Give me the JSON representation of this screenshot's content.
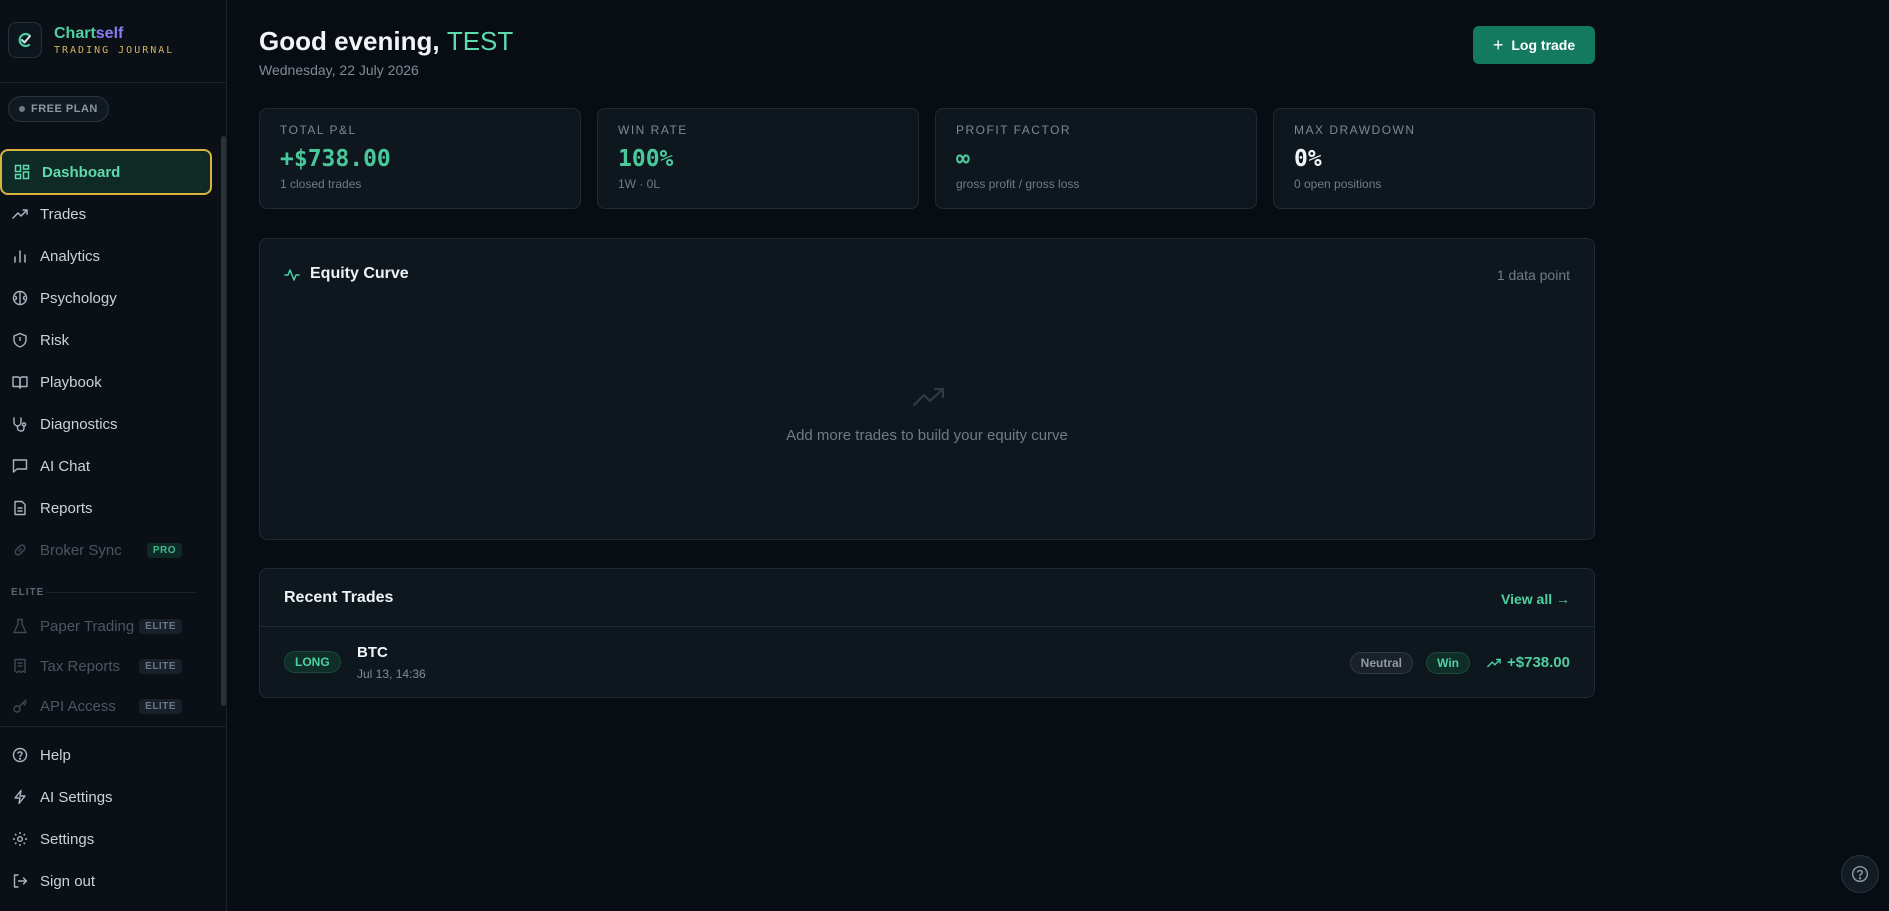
{
  "brand": {
    "name_part1": "Chart",
    "name_part2": "self",
    "subtitle": "TRADING JOURNAL"
  },
  "plan": {
    "label": "FREE PLAN"
  },
  "sidebar": {
    "items": [
      {
        "label": "Dashboard",
        "icon": "dashboard-icon"
      },
      {
        "label": "Trades",
        "icon": "trending-up-icon"
      },
      {
        "label": "Analytics",
        "icon": "bar-chart-icon"
      },
      {
        "label": "Psychology",
        "icon": "brain-icon"
      },
      {
        "label": "Risk",
        "icon": "shield-icon"
      },
      {
        "label": "Playbook",
        "icon": "book-icon"
      },
      {
        "label": "Diagnostics",
        "icon": "stethoscope-icon"
      },
      {
        "label": "AI Chat",
        "icon": "chat-icon"
      },
      {
        "label": "Reports",
        "icon": "document-icon"
      },
      {
        "label": "Broker Sync",
        "icon": "link-icon",
        "tag": "PRO"
      }
    ],
    "elite_label": "ELITE",
    "elite_items": [
      {
        "label": "Paper Trading",
        "icon": "flask-icon",
        "tag": "ELITE"
      },
      {
        "label": "Tax Reports",
        "icon": "receipt-icon",
        "tag": "ELITE"
      },
      {
        "label": "API Access",
        "icon": "key-icon",
        "tag": "ELITE"
      }
    ],
    "bottom_items": [
      {
        "label": "Help",
        "icon": "help-circle-icon"
      },
      {
        "label": "AI Settings",
        "icon": "bolt-icon"
      },
      {
        "label": "Settings",
        "icon": "gear-icon"
      },
      {
        "label": "Sign out",
        "icon": "logout-icon"
      }
    ]
  },
  "header": {
    "greeting": "Good evening,",
    "user": "TEST",
    "date": "Wednesday, 22 July 2026",
    "log_trade_label": "Log trade"
  },
  "stats": [
    {
      "label": "TOTAL P&L",
      "value": "+$738.00",
      "sub": "1 closed trades"
    },
    {
      "label": "WIN RATE",
      "value": "100%",
      "sub": "1W · 0L"
    },
    {
      "label": "PROFIT FACTOR",
      "value": "∞",
      "sub": "gross profit / gross loss"
    },
    {
      "label": "MAX DRAWDOWN",
      "value": "0%",
      "sub": "0 open positions"
    }
  ],
  "equity": {
    "title": "Equity Curve",
    "count": "1 data point",
    "empty_message": "Add more trades to build your equity curve"
  },
  "recent": {
    "title": "Recent Trades",
    "view_all": "View all →",
    "trades": [
      {
        "side": "LONG",
        "symbol": "BTC",
        "time": "Jul 13, 14:36",
        "emotion": "Neutral",
        "result": "Win",
        "pnl": "+$738.00"
      }
    ]
  },
  "colors": {
    "accent": "#4fd0a2",
    "button": "#137a5f",
    "active_border": "#d9b440",
    "brand_purple": "#8b7cf3"
  }
}
